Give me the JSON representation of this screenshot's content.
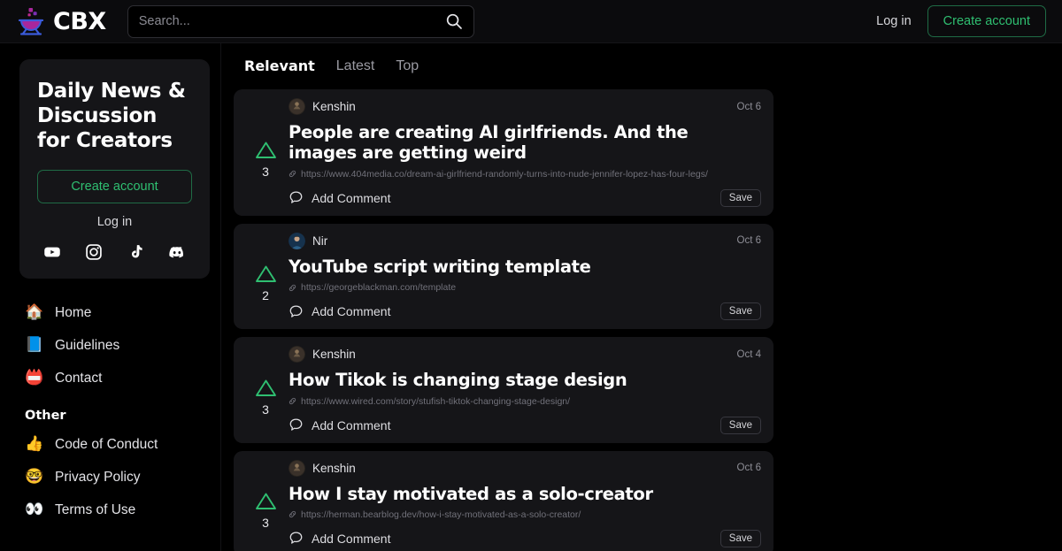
{
  "header": {
    "brand_name": "CBX",
    "logo_icon": "cauldron-logo",
    "search": {
      "value": "",
      "placeholder": "Search...",
      "icon": "search-icon"
    },
    "login_label": "Log in",
    "create_account_label": "Create account"
  },
  "colors": {
    "page_bg": "#000000",
    "card_bg": "#151518",
    "accent_green": "#2fbf71",
    "border_green": "#1f6b45",
    "text_primary": "#ffffff",
    "text_muted": "#8e8e96",
    "logo_purple": "#a8279c",
    "logo_blue": "#3b5bdb"
  },
  "sidebar": {
    "promo": {
      "title": "Daily News & Discussion for Creators",
      "create_account_label": "Create account",
      "login_label": "Log in",
      "socials": [
        {
          "name": "youtube-icon",
          "label": "YouTube"
        },
        {
          "name": "instagram-icon",
          "label": "Instagram"
        },
        {
          "name": "tiktok-icon",
          "label": "TikTok"
        },
        {
          "name": "discord-icon",
          "label": "Discord"
        }
      ]
    },
    "nav": [
      {
        "emoji": "🏠",
        "label": "Home",
        "icon": "house-icon"
      },
      {
        "emoji": "📘",
        "label": "Guidelines",
        "icon": "blue-book-icon"
      },
      {
        "emoji": "📛",
        "label": "Contact",
        "icon": "name-badge-icon"
      }
    ],
    "other_heading": "Other",
    "other": [
      {
        "emoji": "👍",
        "label": "Code of Conduct",
        "icon": "thumbs-up-icon"
      },
      {
        "emoji": "🤓",
        "label": "Privacy Policy",
        "icon": "nerd-face-icon"
      },
      {
        "emoji": "👀",
        "label": "Terms of Use",
        "icon": "eyes-icon"
      }
    ]
  },
  "main": {
    "tabs": [
      {
        "label": "Relevant",
        "active": true
      },
      {
        "label": "Latest",
        "active": false
      },
      {
        "label": "Top",
        "active": false
      }
    ],
    "comment_label": "Add Comment",
    "save_label": "Save",
    "posts": [
      {
        "author": "Kenshin",
        "avatar": "kenshin-avatar",
        "date": "Oct 6",
        "title": "People are creating AI girlfriends. And the images are getting weird",
        "url": "https://www.404media.co/dream-ai-girlfriend-randomly-turns-into-nude-jennifer-lopez-has-four-legs/",
        "votes": "3"
      },
      {
        "author": "Nir",
        "avatar": "nir-avatar",
        "date": "Oct 6",
        "title": "YouTube script writing template",
        "url": "https://georgeblackman.com/template",
        "votes": "2"
      },
      {
        "author": "Kenshin",
        "avatar": "kenshin-avatar",
        "date": "Oct 4",
        "title": "How Tikok is changing stage design",
        "url": "https://www.wired.com/story/stufish-tiktok-changing-stage-design/",
        "votes": "3"
      },
      {
        "author": "Kenshin",
        "avatar": "kenshin-avatar",
        "date": "Oct 6",
        "title": "How I stay motivated as a solo-creator",
        "url": "https://herman.bearblog.dev/how-i-stay-motivated-as-a-solo-creator/",
        "votes": "3"
      }
    ]
  }
}
